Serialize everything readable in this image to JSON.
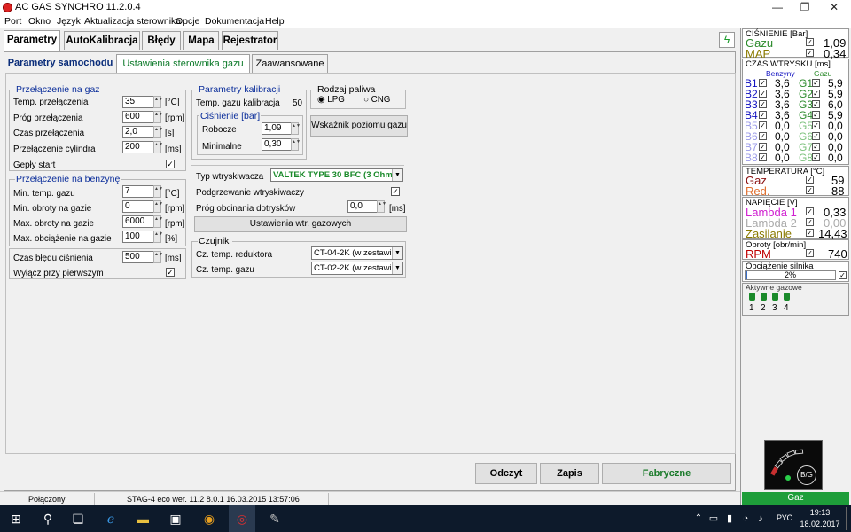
{
  "app": {
    "title": "AC GAS SYNCHRO  11.2.0.4"
  },
  "window_buttons": {
    "minimize": "—",
    "maximize": "❐",
    "close": "✕"
  },
  "menu": [
    "Port",
    "Okno",
    "Język",
    "Aktualizacja sterownika",
    "Opcje",
    "Dokumentacja",
    "Help"
  ],
  "tabs": [
    "Parametry",
    "AutoKalibracja",
    "Błędy",
    "Mapa",
    "Rejestrator"
  ],
  "subtabs": [
    "Parametry samochodu",
    "Ustawienia sterownika gazu",
    "Zaawansowane"
  ],
  "switch_to_gas": {
    "title": "Przełączenie na gaz",
    "rows": [
      {
        "label": "Temp. przełączenia",
        "value": "35",
        "unit": "[°C]"
      },
      {
        "label": "Próg przełączenia",
        "value": "600",
        "unit": "[rpm]"
      },
      {
        "label": "Czas przełączenia",
        "value": "2,0",
        "unit": "[s]"
      },
      {
        "label": "Przełączenie cylindra",
        "value": "200",
        "unit": "[ms]"
      }
    ],
    "hot_start": {
      "label": "Gepły start",
      "checked": "✓"
    }
  },
  "switch_to_petrol": {
    "title": "Przełączenie na benzynę",
    "rows": [
      {
        "label": "Min. temp. gazu",
        "value": "7",
        "unit": "[°C]"
      },
      {
        "label": "Min. obroty na gazie",
        "value": "0",
        "unit": "[rpm]"
      },
      {
        "label": "Max. obroty na gazie",
        "value": "6000",
        "unit": "[rpm]"
      },
      {
        "label": "Max. obciążenie na gazie",
        "value": "100",
        "unit": "[%]"
      }
    ],
    "pressure_error": {
      "label": "Czas błędu ciśnienia",
      "value": "500",
      "unit": "[ms]"
    },
    "disable_first": {
      "label": "Wyłącz przy pierwszym",
      "checked": "✓"
    }
  },
  "calibration": {
    "title": "Parametry kalibracji",
    "gas_temp_label": "Temp. gazu kalibracja",
    "gas_temp_value": "50",
    "pressure_title": "Ciśnienie [bar]",
    "working_label": "Robocze",
    "working_value": "1,09",
    "minimal_label": "Minimalne",
    "minimal_value": "0,30"
  },
  "fuel_type": {
    "title": "Rodzaj paliwa",
    "lpg": "LPG",
    "cng": "CNG"
  },
  "fuel_level_button": "Wskaźnik poziomu gazu",
  "injector": {
    "type_label": "Typ wtryskiwacza",
    "type_value": "VALTEK TYPE 30 BFC (3 Ohm)",
    "heating_label": "Podgrzewanie wtryskiwaczy",
    "heating_checked": "✓",
    "cutoff_label": "Próg obcinania dotrysków",
    "cutoff_value": "0,0",
    "cutoff_unit": "[ms]",
    "settings_button": "Ustawienia wtr. gazowych"
  },
  "sensors": {
    "title": "Czujniki",
    "reducer_label": "Cz. temp. reduktora",
    "reducer_value": "CT-04-2K (w zestawi",
    "gas_label": "Cz. temp. gazu",
    "gas_value": "CT-02-2K (w zestawi"
  },
  "bottom_buttons": {
    "read": "Odczyt",
    "save": "Zapis",
    "factory": "Fabryczne"
  },
  "status": {
    "connection": "Połączony",
    "device": "STAG-4 eco   wer. 11.2  8.0.1    16.03.2015 13:57:06"
  },
  "right": {
    "pressure": {
      "title": "CIŚNIENIE [Bar]",
      "gas_label": "Gazu",
      "gas_value": "1,09",
      "map_label": "MAP",
      "map_value": "0,34"
    },
    "injection": {
      "title": "CZAS WTRYSKU  [ms]",
      "petrol_header": "Benzyny",
      "gas_header": "Gazu",
      "rows": [
        {
          "b": "B1",
          "bv": "3,6",
          "g": "G1",
          "gv": "5,9"
        },
        {
          "b": "B2",
          "bv": "3,6",
          "g": "G2",
          "gv": "5,9"
        },
        {
          "b": "B3",
          "bv": "3,6",
          "g": "G3",
          "gv": "6,0"
        },
        {
          "b": "B4",
          "bv": "3,6",
          "g": "G4",
          "gv": "5,9"
        },
        {
          "b": "B5",
          "bv": "0,0",
          "g": "G5",
          "gv": "0,0"
        },
        {
          "b": "B6",
          "bv": "0,0",
          "g": "G6",
          "gv": "0,0"
        },
        {
          "b": "B7",
          "bv": "0,0",
          "g": "G7",
          "gv": "0,0"
        },
        {
          "b": "B8",
          "bv": "0,0",
          "g": "G8",
          "gv": "0,0"
        }
      ]
    },
    "temperature": {
      "title": "TEMPERATURA  [°C]",
      "gas_label": "Gaz",
      "gas_value": "59",
      "red_label": "Red.",
      "red_value": "88"
    },
    "voltage": {
      "title": "NAPIĘCIE [V]",
      "l1_label": "Lambda 1",
      "l1_value": "0,33",
      "l2_label": "Lambda 2",
      "l2_value": "0,00",
      "sup_label": "Zasilanie",
      "sup_value": "14,43"
    },
    "rpm": {
      "title": "Obroty [obr/min]",
      "label": "RPM",
      "value": "740"
    },
    "load": {
      "title": "Obciążenie silnika",
      "value": "2%"
    },
    "active": {
      "title": "Aktywne gazowe",
      "nums": [
        "1",
        "2",
        "3",
        "4"
      ]
    },
    "switch_label": "B/G",
    "mode": "Gaz"
  },
  "taskbar": {
    "lang": "РУС",
    "time": "19:13",
    "date": "18.02.2017"
  },
  "colors": {
    "gas_green": "#2a8a2a",
    "petrol_blue": "#1010c0",
    "mode_bar": "#1e9e3a",
    "lambda": "#d020d0",
    "temp_red": "#e07030"
  }
}
